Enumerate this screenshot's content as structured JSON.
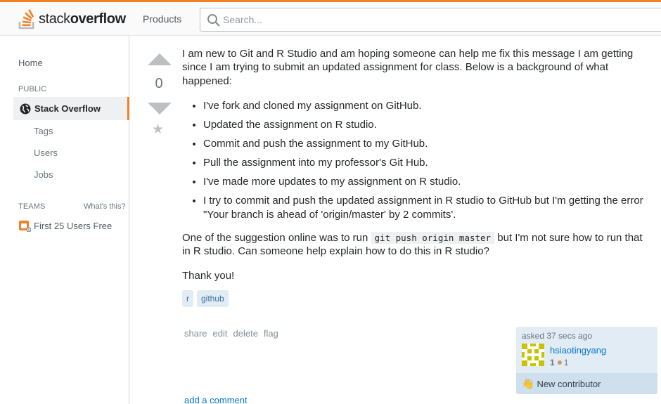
{
  "header": {
    "logo_text_light": "stack",
    "logo_text_bold": "overflow",
    "products_label": "Products",
    "search_placeholder": "Search..."
  },
  "sidebar": {
    "home": "Home",
    "public_heading": "PUBLIC",
    "active_item": "Stack Overflow",
    "sub_items": [
      "Tags",
      "Users",
      "Jobs"
    ],
    "teams_heading": "TEAMS",
    "whats_this": "What's this?",
    "team_promo": "First 25 Users Free"
  },
  "post": {
    "vote_count": "0",
    "intro": "I am new to Git and R Studio and am hoping someone can help me fix this message I am getting since I am trying to submit an updated assignment for class. Below is a background of what happened:",
    "bullets": [
      "I've fork and cloned my assignment on GitHub.",
      "Updated the assignment on R studio.",
      "Commit and push the assignment to my GitHub.",
      "Pull the assignment into my professor's Git Hub.",
      "I've made more updates to my assignment on R studio.",
      "I try to commit and push the updated assignment in R studio to GitHub but I'm getting the error \"Your branch is ahead of 'origin/master' by 2 commits'."
    ],
    "suggestion_before": "One of the suggestion online was to run ",
    "suggestion_code": "git push origin master",
    "suggestion_after": " but I'm not sure how to run that in R studio. Can someone help explain how to do this in R studio?",
    "thanks": "Thank you!",
    "tags": [
      "r",
      "github"
    ],
    "menu": [
      "share",
      "edit",
      "delete",
      "flag"
    ],
    "add_comment": "add a comment"
  },
  "owner": {
    "asked": "asked 37 secs ago",
    "username": "hsiaotingyang",
    "reputation": "1",
    "bronze_badges": "1",
    "new_contributor": "New contributor"
  },
  "colors": {
    "accent": "#f48024",
    "link": "#0077cc",
    "tag_bg": "#e1ecf4",
    "tag_text": "#39739d"
  }
}
